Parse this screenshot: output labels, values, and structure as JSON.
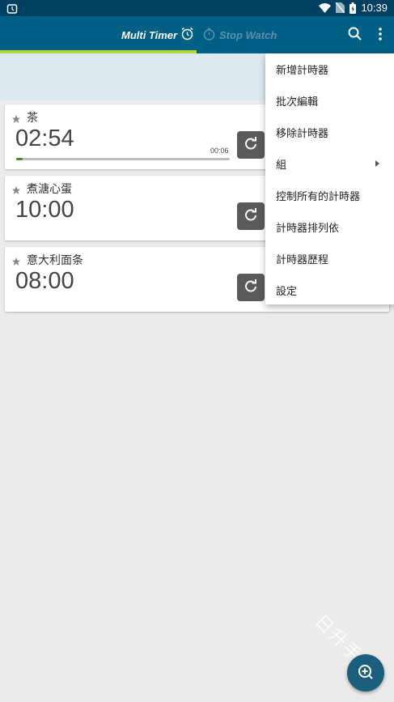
{
  "status_bar": {
    "time": "10:39",
    "icons": [
      "alarm-icon",
      "wifi-icon",
      "no-sim-icon",
      "battery-icon"
    ]
  },
  "app_bar": {
    "tabs": [
      {
        "label": "Multi Timer",
        "icon": "alarm-clock-icon",
        "active": true
      },
      {
        "label": "Stop Watch",
        "icon": "stopwatch-icon",
        "active": false
      }
    ],
    "actions": [
      "search-icon",
      "more-vert-icon"
    ]
  },
  "timers": [
    {
      "name": "茶",
      "time": "02:54",
      "elapsed": "00:06",
      "progress": 0.03,
      "starred": false
    },
    {
      "name": "煮溏心蛋",
      "time": "10:00",
      "elapsed": "",
      "progress": 0,
      "starred": false
    },
    {
      "name": "意大利面条",
      "time": "08:00",
      "elapsed": "",
      "progress": 0,
      "starred": false
    }
  ],
  "menu": {
    "items": [
      {
        "label": "新增計時器"
      },
      {
        "label": "批次編輯"
      },
      {
        "label": "移除計時器"
      },
      {
        "label": "組",
        "has_submenu": true
      },
      {
        "label": "控制所有的計時器"
      },
      {
        "label": "計時器排列依"
      },
      {
        "label": "計時器歷程"
      },
      {
        "label": "設定"
      }
    ]
  },
  "watermark": "日升手游",
  "colors": {
    "status_bar": "#004060",
    "app_bar": "#005f85",
    "tab_indicator": "#b8d53c",
    "header_panel": "#dbe9f1",
    "progress_fill": "#4b8b2d",
    "fab": "#1c5f7c"
  }
}
